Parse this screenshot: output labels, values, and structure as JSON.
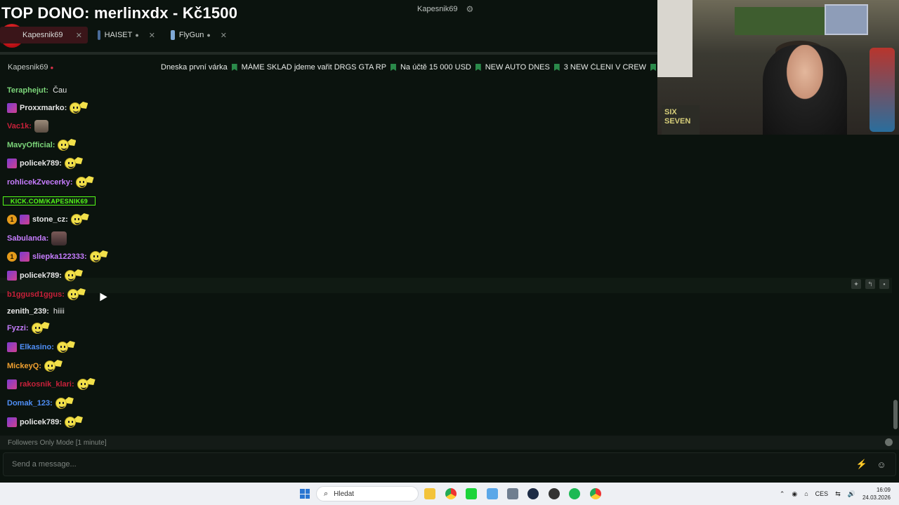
{
  "header": {
    "title": "TOP DONO: merlinxdx - Kč1500",
    "channel_label": "Kapesnik69"
  },
  "tabs": [
    {
      "label": "Kapesnik69",
      "color": "#3a1519"
    },
    {
      "label": "HAISET",
      "color": "#4a6b9a"
    },
    {
      "label": "FlyGun",
      "color": "#7fa8d6"
    }
  ],
  "channel_bar": {
    "name": "Kapesnik69",
    "ticker": [
      "Dneska první várka",
      "MÁME SKLAD jdeme vařit DRGS GTA RP",
      "Na účtě 15 000 USD",
      "NEW AUTO DNES",
      "3 NEW ČLENI V CREW"
    ]
  },
  "kick_banner": "KICK.COM/KAPESNIK69",
  "chat": [
    {
      "user": "Teraphejut:",
      "color": "#7cd67a",
      "text": "Čau",
      "badges": [],
      "emote": ""
    },
    {
      "user": "Proxxmarko:",
      "color": "#e6e6e6",
      "text": "",
      "badges": [
        "sub"
      ],
      "emote": "smile-wave"
    },
    {
      "user": "Vac1k:",
      "color": "#c8213a",
      "text": "",
      "badges": [],
      "emote": "cat"
    },
    {
      "user": "MavyOfficial:",
      "color": "#7cd67a",
      "text": "",
      "badges": [],
      "emote": "smile-wave"
    },
    {
      "user": "policek789:",
      "color": "#e6e6e6",
      "text": "",
      "badges": [
        "sub"
      ],
      "emote": "smile-wave"
    },
    {
      "user": "rohlicekZvecerky:",
      "color": "#c77dff",
      "text": "",
      "badges": [],
      "emote": "smile-wave"
    },
    {
      "user": "stone_cz:",
      "color": "#e6e6e6",
      "text": "",
      "badges": [
        "one",
        "sub"
      ],
      "emote": "smile-wave"
    },
    {
      "user": "Sabulanda:",
      "color": "#c77dff",
      "text": "",
      "badges": [],
      "emote": "face"
    },
    {
      "user": "sliepka122333:",
      "color": "#c77dff",
      "text": "",
      "badges": [
        "one",
        "sub"
      ],
      "emote": "smile-wave"
    },
    {
      "user": "policek789:",
      "color": "#e6e6e6",
      "text": "",
      "badges": [
        "sub"
      ],
      "emote": "smile-wave"
    },
    {
      "user": "b1ggusd1ggus:",
      "color": "#c8213a",
      "text": "",
      "badges": [],
      "emote": "smile-wave"
    },
    {
      "user": "zenith_239:",
      "color": "#e6e6e6",
      "text": "hiiii",
      "badges": [],
      "emote": ""
    },
    {
      "user": "Fyzzi:",
      "color": "#c77dff",
      "text": "",
      "badges": [],
      "emote": "smile-wave"
    },
    {
      "user": "Elkasino:",
      "color": "#4f8ff7",
      "text": "",
      "badges": [
        "sub"
      ],
      "emote": "smile-wave"
    },
    {
      "user": "MickeyQ:",
      "color": "#f0a030",
      "text": "",
      "badges": [],
      "emote": "smile-wave"
    },
    {
      "user": "rakosnik_klari:",
      "color": "#c8213a",
      "text": "",
      "badges": [
        "sub"
      ],
      "emote": "smile-wave"
    },
    {
      "user": "Domak_123:",
      "color": "#4f8ff7",
      "text": "",
      "badges": [],
      "emote": "smile-wave"
    },
    {
      "user": "policek789:",
      "color": "#e6e6e6",
      "text": "",
      "badges": [
        "sub"
      ],
      "emote": "smile-wave"
    }
  ],
  "footer": {
    "mode_text": "Followers Only Mode [1 minute]",
    "input_placeholder": "Send a message..."
  },
  "taskbar": {
    "search_placeholder": "Hledat",
    "language": "CES",
    "time": "16:09",
    "date": "24.03.2026"
  },
  "webcam": {
    "sign_text": "SIX SEVEN"
  }
}
